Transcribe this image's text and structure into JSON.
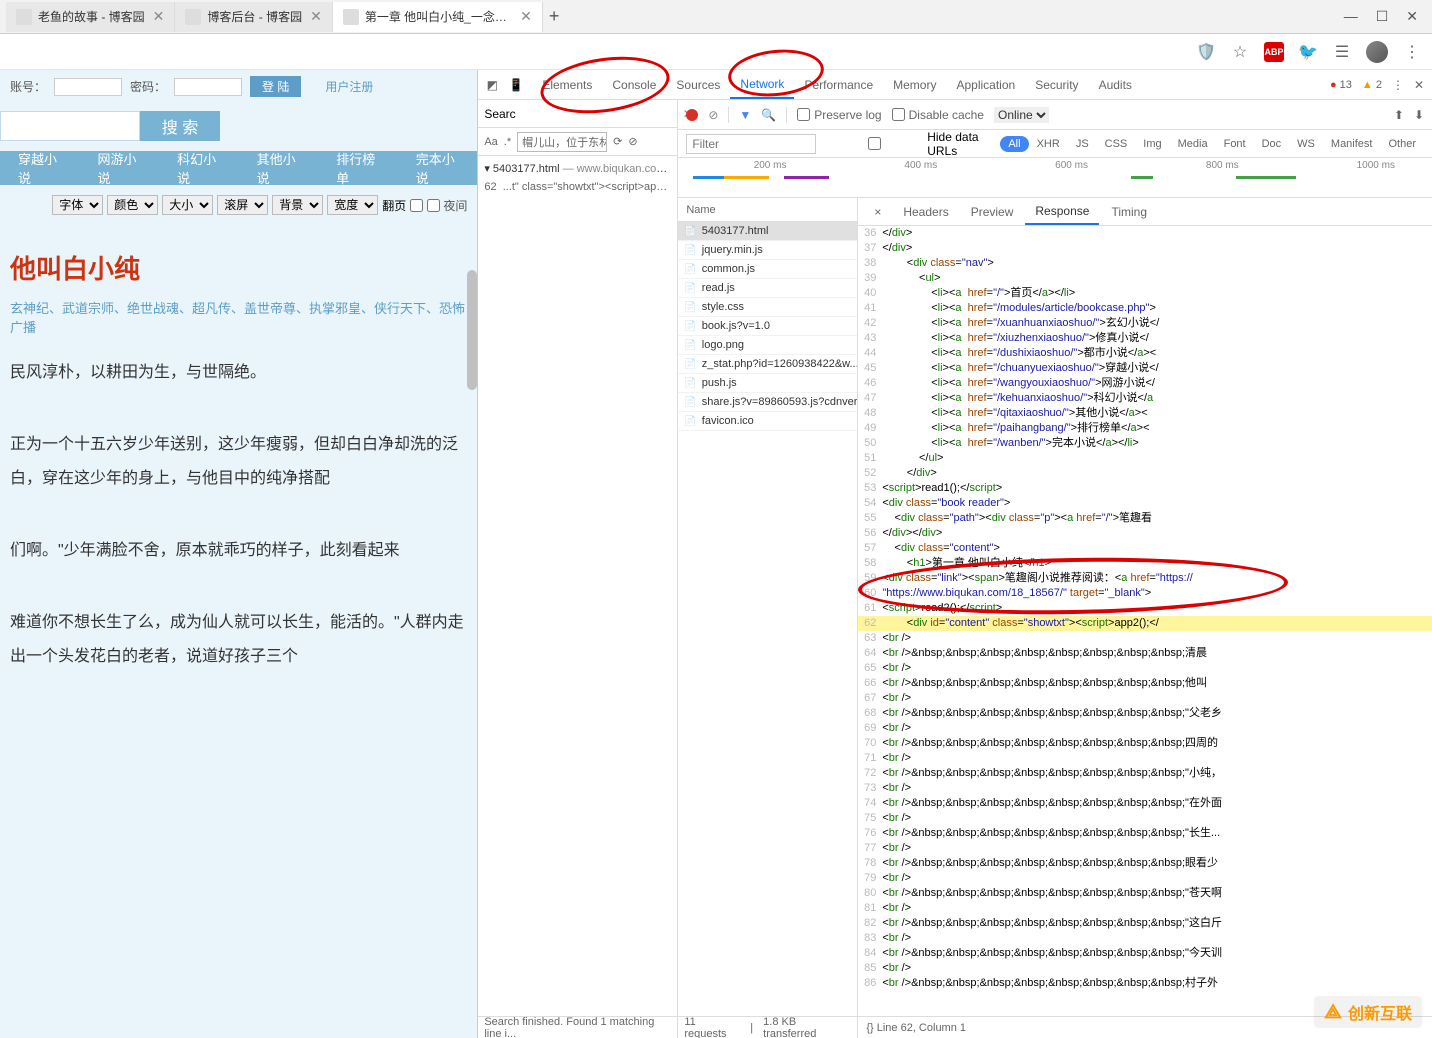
{
  "chrome": {
    "tabs": [
      {
        "label": "老鱼的故事 - 博客园",
        "active": false
      },
      {
        "label": "博客后台 - 博客园",
        "active": false
      },
      {
        "label": "第一章 他叫白小纯_一念永恒_修...",
        "active": true
      }
    ],
    "window_controls": {
      "min": "—",
      "max": "☐",
      "close": "✕"
    },
    "ext_icons": [
      "shield",
      "star",
      "abp",
      "bird",
      "bug",
      "avatar",
      "more"
    ]
  },
  "page": {
    "login": {
      "acct_label": "账号：",
      "pwd_label": "密码：",
      "login_btn": "登 陆",
      "register": "用户注册"
    },
    "search_btn": "搜 索",
    "nav": [
      "穿越小说",
      "网游小说",
      "科幻小说",
      "其他小说",
      "排行榜单",
      "完本小说"
    ],
    "settings": {
      "font": "字体",
      "color": "颜色",
      "size": "大小",
      "scroll": "滚屏",
      "bg": "背景",
      "width": "宽度",
      "flip": "翻页",
      "night": "夜间"
    },
    "chapter_title": "他叫白小纯",
    "tags": "玄神纪、武道宗师、绝世战魂、超凡传、盖世帝尊、执掌邪皇、侠行天下、恐怖广播",
    "paragraphs": [
      "民风淳朴，以耕田为生，与世隔绝。",
      "正为一个十五六岁少年送别，这少年瘦弱，但却白白净却洗的泛白，穿在这少年的身上，与他目中的纯净搭配",
      "们啊。\"少年满脸不舍，原本就乖巧的样子，此刻看起来",
      "难道你不想长生了么，成为仙人就可以长生，能活的。\"人群内走出一个头发花白的老者，说道好孩子三个"
    ]
  },
  "devtools": {
    "tabs": [
      "Elements",
      "Console",
      "Sources",
      "Network",
      "Performance",
      "Memory",
      "Application",
      "Security",
      "Audits"
    ],
    "active_tab": "Network",
    "errors": "13",
    "warnings": "2",
    "search_label": "Searc",
    "find_opts": {
      "aa": "Aa",
      "re": ".*",
      "value": "帽儿山，位于东林"
    },
    "source_entry": {
      "file": "5403177.html",
      "origin": "www.biqukan.com/1...",
      "line": "62",
      "snippet": "...t\" class=\"showtxt\"><script>app..."
    },
    "footer_left": "Search finished. Found 1 matching line i...",
    "net_toolbar": {
      "preserve": "Preserve log",
      "disable": "Disable cache",
      "online": "Online",
      "hide_urls": "Hide data URLs",
      "filter_placeholder": "Filter"
    },
    "net_filter_tabs": [
      "All",
      "XHR",
      "JS",
      "CSS",
      "Img",
      "Media",
      "Font",
      "Doc",
      "WS",
      "Manifest",
      "Other"
    ],
    "timeline_ticks": [
      "200 ms",
      "400 ms",
      "600 ms",
      "800 ms",
      "1000 ms"
    ],
    "requests": {
      "header": "Name",
      "items": [
        "5403177.html",
        "jquery.min.js",
        "common.js",
        "read.js",
        "style.css",
        "book.js?v=1.0",
        "logo.png",
        "z_stat.php?id=1260938422&w...",
        "push.js",
        "share.js?v=89860593.js?cdnver...",
        "favicon.ico"
      ]
    },
    "req_footer": {
      "count": "11 requests",
      "size": "1.8 KB transferred"
    },
    "resp_tabs": [
      "Headers",
      "Preview",
      "Response",
      "Timing"
    ],
    "resp_active": "Response",
    "resp_x": "×",
    "resp_footer": "{}  Line 62, Column 1",
    "code_lines": [
      {
        "n": 36,
        "html": "&lt;/<span class='tg'>div</span>&gt;"
      },
      {
        "n": 37,
        "html": "&lt;/<span class='tg'>div</span>&gt;"
      },
      {
        "n": 38,
        "html": "        &lt;<span class='tg'>div</span> <span class='at'>class</span>=<span class='st'>\"nav\"</span>&gt;"
      },
      {
        "n": 39,
        "html": "            &lt;<span class='tg'>ul</span>&gt;"
      },
      {
        "n": 40,
        "html": "                &lt;<span class='tg'>li</span>&gt;&lt;<span class='tg'>a</span>  <span class='at'>href</span>=<span class='st'>\"/\"</span>&gt;首页&lt;/<span class='tg'>a</span>&gt;&lt;/<span class='tg'>li</span>&gt;"
      },
      {
        "n": 41,
        "html": "                &lt;<span class='tg'>li</span>&gt;&lt;<span class='tg'>a</span>  <span class='at'>href</span>=<span class='st'>\"/modules/article/bookcase.php\"</span>&gt;"
      },
      {
        "n": 42,
        "html": "                &lt;<span class='tg'>li</span>&gt;&lt;<span class='tg'>a</span>  <span class='at'>href</span>=<span class='st'>\"/xuanhuanxiaoshuo/\"</span>&gt;玄幻小说&lt;/"
      },
      {
        "n": 43,
        "html": "                &lt;<span class='tg'>li</span>&gt;&lt;<span class='tg'>a</span>  <span class='at'>href</span>=<span class='st'>\"/xiuzhenxiaoshuo/\"</span>&gt;修真小说&lt;/"
      },
      {
        "n": 44,
        "html": "                &lt;<span class='tg'>li</span>&gt;&lt;<span class='tg'>a</span>  <span class='at'>href</span>=<span class='st'>\"/dushixiaoshuo/\"</span>&gt;都市小说&lt;/<span class='tg'>a</span>&gt;&lt;"
      },
      {
        "n": 45,
        "html": "                &lt;<span class='tg'>li</span>&gt;&lt;<span class='tg'>a</span>  <span class='at'>href</span>=<span class='st'>\"/chuanyuexiaoshuo/\"</span>&gt;穿越小说&lt;/"
      },
      {
        "n": 46,
        "html": "                &lt;<span class='tg'>li</span>&gt;&lt;<span class='tg'>a</span>  <span class='at'>href</span>=<span class='st'>\"/wangyouxiaoshuo/\"</span>&gt;网游小说&lt;/"
      },
      {
        "n": 47,
        "html": "                &lt;<span class='tg'>li</span>&gt;&lt;<span class='tg'>a</span>  <span class='at'>href</span>=<span class='st'>\"/kehuanxiaoshuo/\"</span>&gt;科幻小说&lt;/<span class='tg'>a</span>"
      },
      {
        "n": 48,
        "html": "                &lt;<span class='tg'>li</span>&gt;&lt;<span class='tg'>a</span>  <span class='at'>href</span>=<span class='st'>\"/qitaxiaoshuo/\"</span>&gt;其他小说&lt;/<span class='tg'>a</span>&gt;&lt;"
      },
      {
        "n": 49,
        "html": "                &lt;<span class='tg'>li</span>&gt;&lt;<span class='tg'>a</span>  <span class='at'>href</span>=<span class='st'>\"/paihangbang/\"</span>&gt;排行榜单&lt;/<span class='tg'>a</span>&gt;&lt;"
      },
      {
        "n": 50,
        "html": "                &lt;<span class='tg'>li</span>&gt;&lt;<span class='tg'>a</span>  <span class='at'>href</span>=<span class='st'>\"/wanben/\"</span>&gt;完本小说&lt;/<span class='tg'>a</span>&gt;&lt;/<span class='tg'>li</span>&gt;"
      },
      {
        "n": 51,
        "html": "            &lt;/<span class='tg'>ul</span>&gt;"
      },
      {
        "n": 52,
        "html": "        &lt;/<span class='tg'>div</span>&gt;"
      },
      {
        "n": 53,
        "html": "&lt;<span class='tg'>script</span>&gt;read1();&lt;/<span class='tg'>script</span>&gt;"
      },
      {
        "n": 54,
        "html": "&lt;<span class='tg'>div</span> <span class='at'>class</span>=<span class='st'>\"book reader\"</span>&gt;"
      },
      {
        "n": 55,
        "html": "    &lt;<span class='tg'>div</span> <span class='at'>class</span>=<span class='st'>\"path\"</span>&gt;&lt;<span class='tg'>div</span> <span class='at'>class</span>=<span class='st'>\"p\"</span>&gt;&lt;<span class='tg'>a</span> <span class='at'>href</span>=<span class='st'>\"/\"</span>&gt;笔趣看"
      },
      {
        "n": 56,
        "html": "&lt;/<span class='tg'>div</span>&gt;&lt;/<span class='tg'>div</span>&gt;"
      },
      {
        "n": 57,
        "html": "    &lt;<span class='tg'>div</span> <span class='at'>class</span>=<span class='st'>\"content\"</span>&gt;"
      },
      {
        "n": 58,
        "html": "        &lt;<span class='tg'>h1</span>&gt;第一章 他叫白小纯&lt;/<span class='tg'>h1</span>&gt;"
      },
      {
        "n": 59,
        "html": "&lt;<span class='tg'>div</span> <span class='at'>class</span>=<span class='st'>\"link\"</span>&gt;&lt;<span class='tg'>span</span>&gt;笔趣阁小说推荐阅读：&lt;<span class='tg'>a</span> <span class='at'>href</span>=<span class='st'>\"https://"
      },
      {
        "n": 60,
        "html": "<span class='st'>\"https://www.biqukan.com/18_18567/\"</span> <span class='at'>target</span>=<span class='st'>\"_blank\"</span>&gt;"
      },
      {
        "n": 61,
        "html": "&lt;<span class='tg'>script</span>&gt;read2();&lt;/<span class='tg'>script</span>&gt;"
      },
      {
        "n": 62,
        "hl": true,
        "html": "        &lt;<span class='tg'>div</span> <span class='at'>id</span>=<span class='st'>\"content\"</span> <span class='at'>class</span>=<span class='st'>\"showtxt\"</span>&gt;&lt;<span class='tg'>script</span>&gt;app2();&lt;/"
      },
      {
        "n": 63,
        "html": "&lt;<span class='tg'>br</span> /&gt;"
      },
      {
        "n": 64,
        "html": "&lt;<span class='tg'>br</span> /&gt;&amp;nbsp;&amp;nbsp;&amp;nbsp;&amp;nbsp;&amp;nbsp;&amp;nbsp;&amp;nbsp;&amp;nbsp;清晨"
      },
      {
        "n": 65,
        "html": "&lt;<span class='tg'>br</span> /&gt;"
      },
      {
        "n": 66,
        "html": "&lt;<span class='tg'>br</span> /&gt;&amp;nbsp;&amp;nbsp;&amp;nbsp;&amp;nbsp;&amp;nbsp;&amp;nbsp;&amp;nbsp;&amp;nbsp;他叫"
      },
      {
        "n": 67,
        "html": "&lt;<span class='tg'>br</span> /&gt;"
      },
      {
        "n": 68,
        "html": "&lt;<span class='tg'>br</span> /&gt;&amp;nbsp;&amp;nbsp;&amp;nbsp;&amp;nbsp;&amp;nbsp;&amp;nbsp;&amp;nbsp;&amp;nbsp;\"父老乡"
      },
      {
        "n": 69,
        "html": "&lt;<span class='tg'>br</span> /&gt;"
      },
      {
        "n": 70,
        "html": "&lt;<span class='tg'>br</span> /&gt;&amp;nbsp;&amp;nbsp;&amp;nbsp;&amp;nbsp;&amp;nbsp;&amp;nbsp;&amp;nbsp;&amp;nbsp;四周的"
      },
      {
        "n": 71,
        "html": "&lt;<span class='tg'>br</span> /&gt;"
      },
      {
        "n": 72,
        "html": "&lt;<span class='tg'>br</span> /&gt;&amp;nbsp;&amp;nbsp;&amp;nbsp;&amp;nbsp;&amp;nbsp;&amp;nbsp;&amp;nbsp;&amp;nbsp;\"小纯，"
      },
      {
        "n": 73,
        "html": "&lt;<span class='tg'>br</span> /&gt;"
      },
      {
        "n": 74,
        "html": "&lt;<span class='tg'>br</span> /&gt;&amp;nbsp;&amp;nbsp;&amp;nbsp;&amp;nbsp;&amp;nbsp;&amp;nbsp;&amp;nbsp;&amp;nbsp;\"在外面"
      },
      {
        "n": 75,
        "html": "&lt;<span class='tg'>br</span> /&gt;"
      },
      {
        "n": 76,
        "html": "&lt;<span class='tg'>br</span> /&gt;&amp;nbsp;&amp;nbsp;&amp;nbsp;&amp;nbsp;&amp;nbsp;&amp;nbsp;&amp;nbsp;&amp;nbsp;\"长生..."
      },
      {
        "n": 77,
        "html": "&lt;<span class='tg'>br</span> /&gt;"
      },
      {
        "n": 78,
        "html": "&lt;<span class='tg'>br</span> /&gt;&amp;nbsp;&amp;nbsp;&amp;nbsp;&amp;nbsp;&amp;nbsp;&amp;nbsp;&amp;nbsp;&amp;nbsp;眼看少"
      },
      {
        "n": 79,
        "html": "&lt;<span class='tg'>br</span> /&gt;"
      },
      {
        "n": 80,
        "html": "&lt;<span class='tg'>br</span> /&gt;&amp;nbsp;&amp;nbsp;&amp;nbsp;&amp;nbsp;&amp;nbsp;&amp;nbsp;&amp;nbsp;&amp;nbsp;\"苍天啊"
      },
      {
        "n": 81,
        "html": "&lt;<span class='tg'>br</span> /&gt;"
      },
      {
        "n": 82,
        "html": "&lt;<span class='tg'>br</span> /&gt;&amp;nbsp;&amp;nbsp;&amp;nbsp;&amp;nbsp;&amp;nbsp;&amp;nbsp;&amp;nbsp;&amp;nbsp;\"这白斤"
      },
      {
        "n": 83,
        "html": "&lt;<span class='tg'>br</span> /&gt;"
      },
      {
        "n": 84,
        "html": "&lt;<span class='tg'>br</span> /&gt;&amp;nbsp;&amp;nbsp;&amp;nbsp;&amp;nbsp;&amp;nbsp;&amp;nbsp;&amp;nbsp;&amp;nbsp;\"今天训"
      },
      {
        "n": 85,
        "html": "&lt;<span class='tg'>br</span> /&gt;"
      },
      {
        "n": 86,
        "html": "&lt;<span class='tg'>br</span> /&gt;&amp;nbsp;&amp;nbsp;&amp;nbsp;&amp;nbsp;&amp;nbsp;&amp;nbsp;&amp;nbsp;&amp;nbsp;村子外"
      }
    ]
  },
  "watermark": "创新互联"
}
